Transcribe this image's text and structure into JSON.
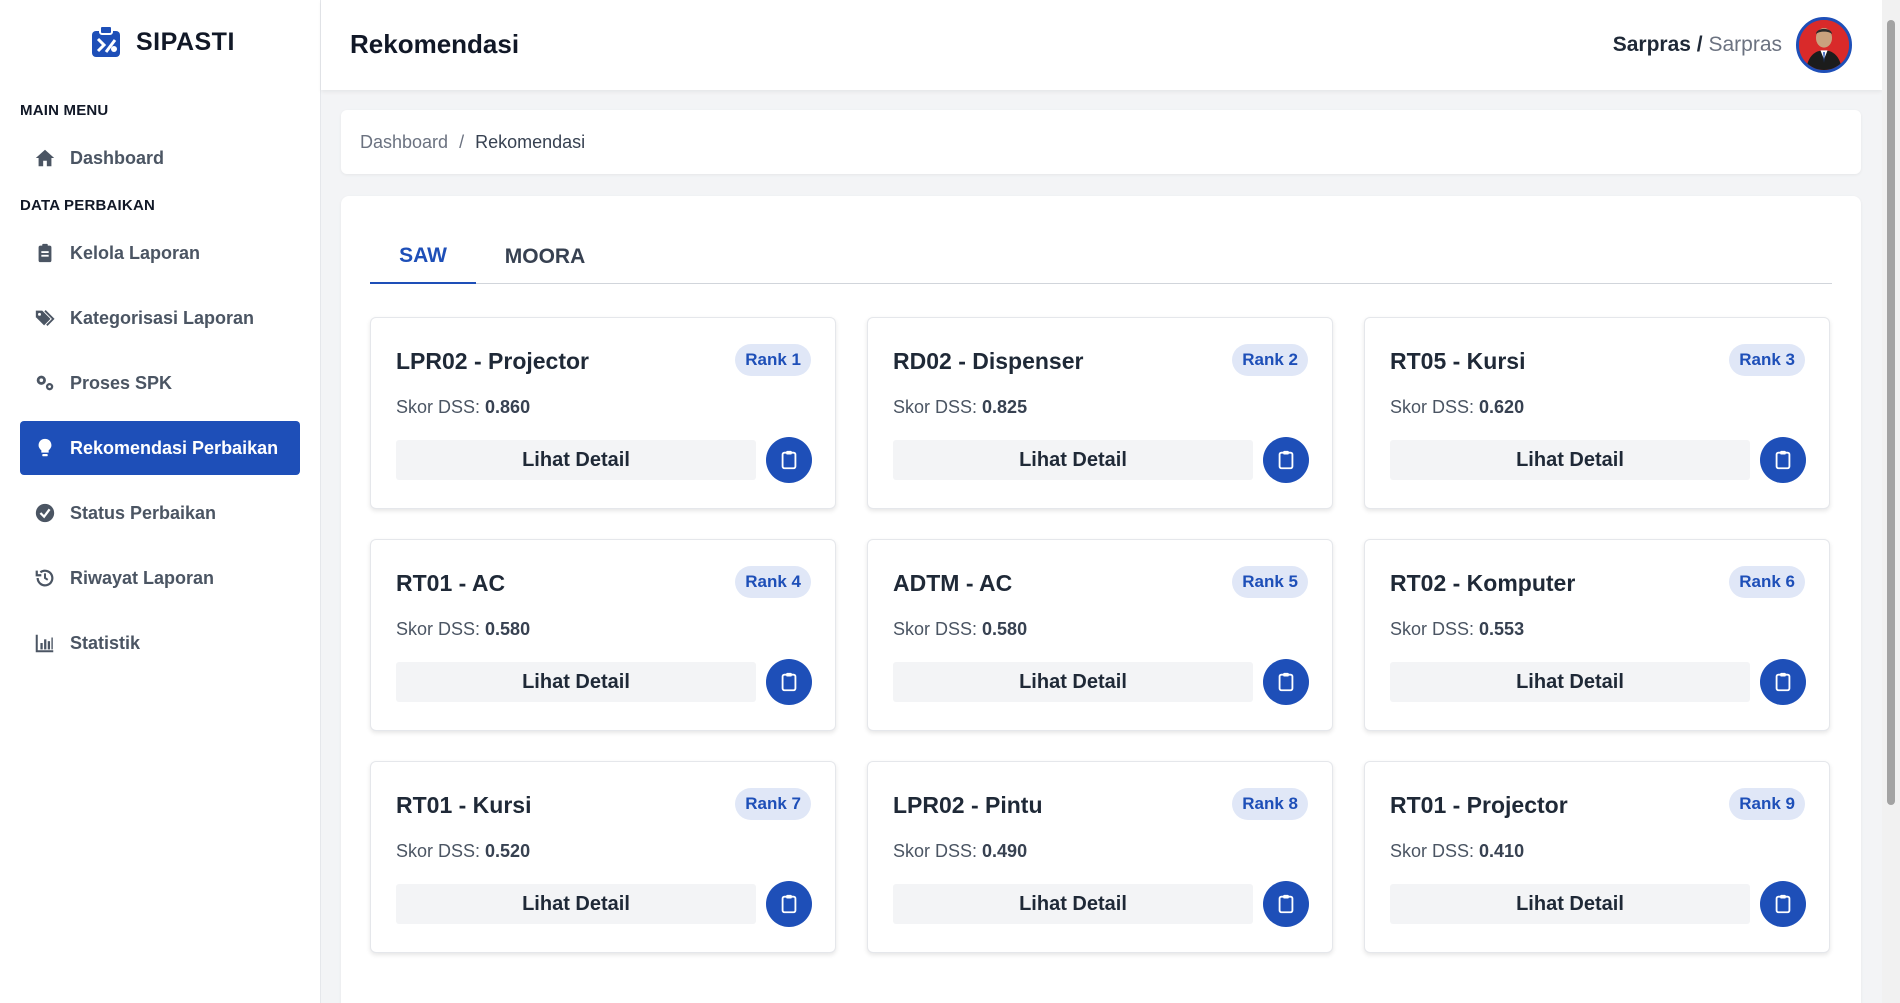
{
  "app": {
    "name": "SIPASTI"
  },
  "sidebar": {
    "sections": [
      {
        "title": "MAIN MENU"
      },
      {
        "title": "DATA PERBAIKAN"
      }
    ],
    "items": [
      {
        "label": "Dashboard",
        "icon": "home-icon"
      },
      {
        "label": "Kelola Laporan",
        "icon": "clipboard-icon"
      },
      {
        "label": "Kategorisasi Laporan",
        "icon": "tags-icon"
      },
      {
        "label": "Proses SPK",
        "icon": "gears-icon"
      },
      {
        "label": "Rekomendasi Perbaikan",
        "icon": "lightbulb-icon",
        "active": true
      },
      {
        "label": "Status Perbaikan",
        "icon": "check-circle-icon"
      },
      {
        "label": "Riwayat Laporan",
        "icon": "history-icon"
      },
      {
        "label": "Statistik",
        "icon": "chart-bar-icon"
      }
    ]
  },
  "header": {
    "title": "Rekomendasi",
    "user_name": "Sarpras",
    "separator": "/",
    "user_role": "Sarpras"
  },
  "breadcrumb": {
    "items": [
      "Dashboard",
      "Rekomendasi"
    ],
    "separator": "/"
  },
  "tabs": [
    {
      "label": "SAW",
      "active": true
    },
    {
      "label": "MOORA",
      "active": false
    }
  ],
  "score_label": "Skor DSS: ",
  "detail_label": "Lihat Detail",
  "cards": [
    {
      "title": "LPR02 - Projector",
      "rank": "Rank 1",
      "score": "0.860"
    },
    {
      "title": "RD02 - Dispenser",
      "rank": "Rank 2",
      "score": "0.825"
    },
    {
      "title": "RT05 - Kursi",
      "rank": "Rank 3",
      "score": "0.620"
    },
    {
      "title": "RT01 - AC",
      "rank": "Rank 4",
      "score": "0.580"
    },
    {
      "title": "ADTM - AC",
      "rank": "Rank 5",
      "score": "0.580"
    },
    {
      "title": "RT02 - Komputer",
      "rank": "Rank 6",
      "score": "0.553"
    },
    {
      "title": "RT01 - Kursi",
      "rank": "Rank 7",
      "score": "0.520"
    },
    {
      "title": "LPR02 - Pintu",
      "rank": "Rank 8",
      "score": "0.490"
    },
    {
      "title": "RT01 - Projector",
      "rank": "Rank 9",
      "score": "0.410"
    }
  ],
  "colors": {
    "primary": "#1e4fb8",
    "badge_bg": "#e0e7f7",
    "button_bg": "#f3f4f6"
  }
}
